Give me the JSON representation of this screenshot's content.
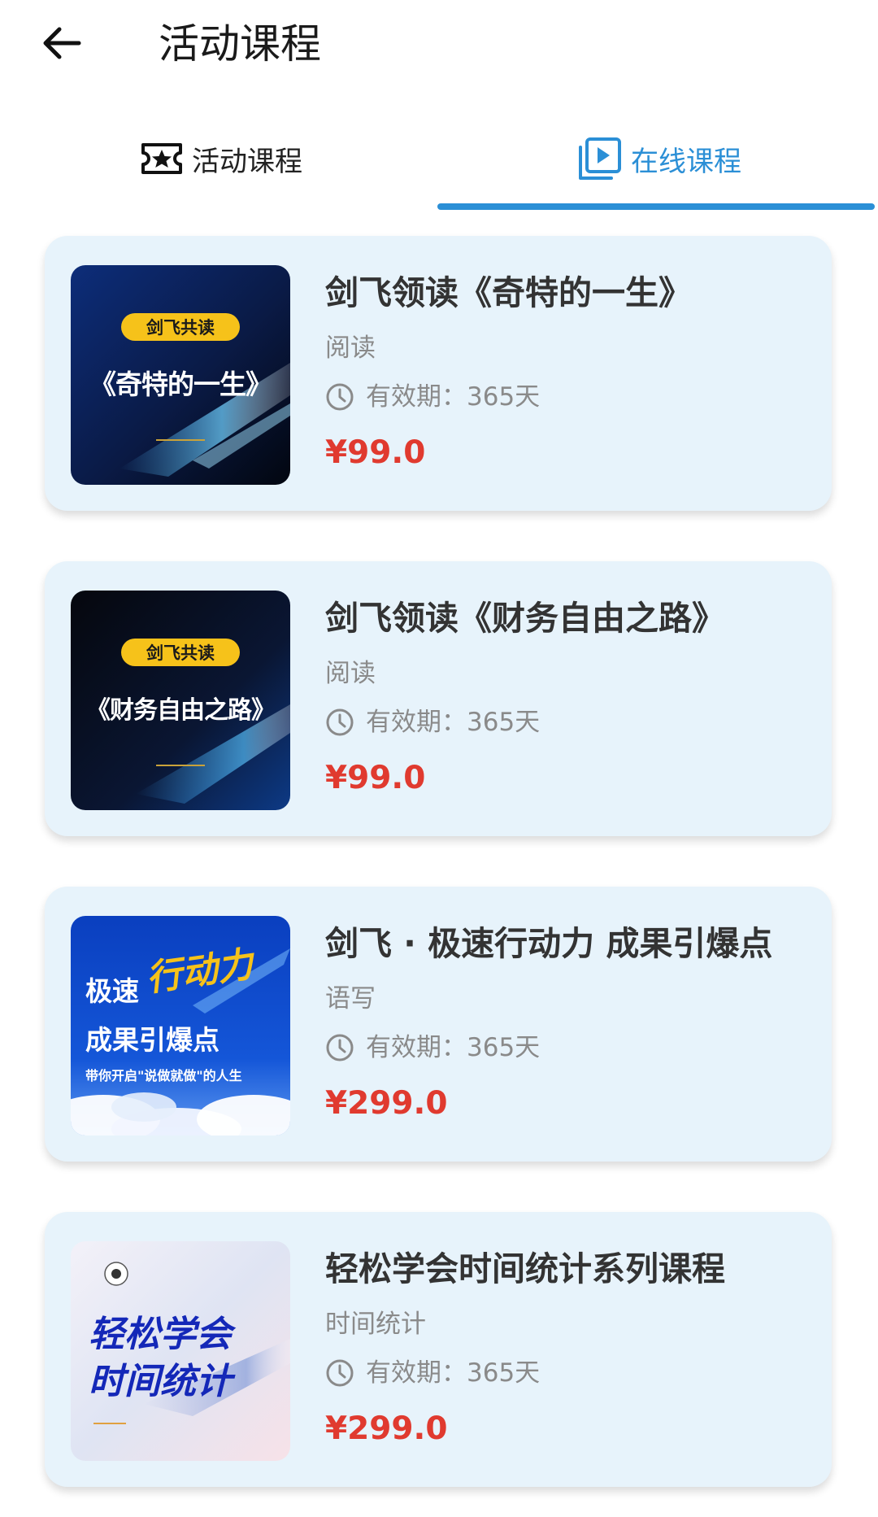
{
  "header": {
    "title": "活动课程",
    "back_icon": "arrow-left-icon"
  },
  "tabs": [
    {
      "label": "活动课程",
      "icon": "ticket-star-icon",
      "active": false
    },
    {
      "label": "在线课程",
      "icon": "play-video-icon",
      "active": true
    }
  ],
  "colors": {
    "accent": "#2b8fd6",
    "price": "#e03a2f",
    "card_bg": "#e7f3fb"
  },
  "courses": [
    {
      "title": "剑飞领读《奇特的一生》",
      "category": "阅读",
      "validity": "有效期：365天",
      "price": "¥99.0",
      "cover": {
        "badge": "剑飞共读",
        "headline": "《奇特的一生》"
      }
    },
    {
      "title": "剑飞领读《财务自由之路》",
      "category": "阅读",
      "validity": "有效期：365天",
      "price": "¥99.0",
      "cover": {
        "badge": "剑飞共读",
        "headline": "《财务自由之路》"
      }
    },
    {
      "title": "剑飞 · 极速行动力 成果引爆点",
      "category": "语写",
      "validity": "有效期：365天",
      "price": "¥299.0",
      "cover": {
        "line1": "极速",
        "script": "行动力",
        "line2": "成果引爆点",
        "tagline": "带你开启\"说做就做\"的人生"
      }
    },
    {
      "title": "轻松学会时间统计系列课程",
      "category": "时间统计",
      "validity": "有效期：365天",
      "price": "¥299.0",
      "cover": {
        "line1": "轻松学会",
        "line2": "时间统计"
      }
    }
  ]
}
